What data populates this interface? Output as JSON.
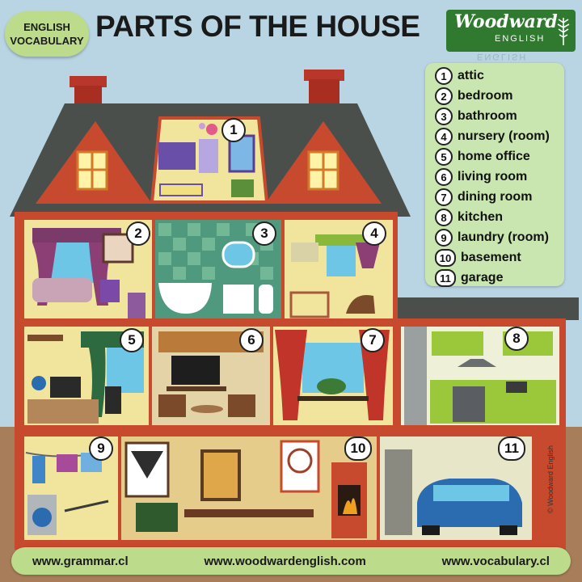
{
  "badge": {
    "line1": "ENGLISH",
    "line2": "VOCABULARY"
  },
  "title": "PARTS OF THE HOUSE",
  "logo": {
    "brand": "Woodward",
    "sub": "ENGLISH"
  },
  "legend": [
    {
      "num": "1",
      "label": "attic"
    },
    {
      "num": "2",
      "label": "bedroom"
    },
    {
      "num": "3",
      "label": "bathroom"
    },
    {
      "num": "4",
      "label": "nursery (room)"
    },
    {
      "num": "5",
      "label": "home office"
    },
    {
      "num": "6",
      "label": "living room"
    },
    {
      "num": "7",
      "label": "dining room"
    },
    {
      "num": "8",
      "label": "kitchen"
    },
    {
      "num": "9",
      "label": "laundry (room)"
    },
    {
      "num": "10",
      "label": "basement"
    },
    {
      "num": "11",
      "label": "garage"
    }
  ],
  "rooms": {
    "n1": "1",
    "n2": "2",
    "n3": "3",
    "n4": "4",
    "n5": "5",
    "n6": "6",
    "n7": "7",
    "n8": "8",
    "n9": "9",
    "n10": "10",
    "n11": "11"
  },
  "credit": "© Woodward English",
  "footer": {
    "left": "www.grammar.cl",
    "center": "www.woodwardenglish.com",
    "right": "www.vocabulary.cl"
  },
  "colors": {
    "roof": "#4a4f4c",
    "brick": "#c74a2e",
    "chimney": "#b8372a",
    "frame": "#b3302a",
    "ground": "#a87e5a",
    "wall": "#f1e59d",
    "green_accent": "#bcdc8b"
  }
}
